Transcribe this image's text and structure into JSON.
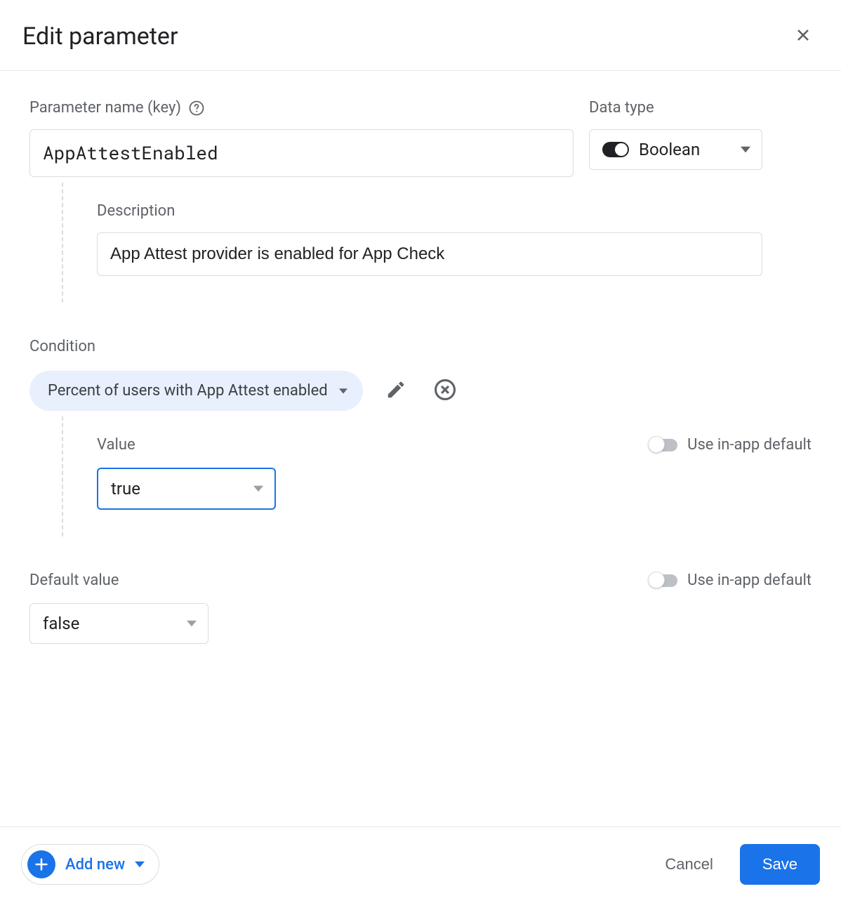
{
  "dialog": {
    "title": "Edit parameter"
  },
  "param": {
    "name_label": "Parameter name (key)",
    "name_value": "AppAttestEnabled",
    "datatype_label": "Data type",
    "datatype_value": "Boolean",
    "description_label": "Description",
    "description_value": "App Attest provider is enabled for App Check"
  },
  "condition": {
    "label": "Condition",
    "chip_text": "Percent of users with App Attest enabled",
    "value_label": "Value",
    "value_selected": "true",
    "use_default_label": "Use in-app default"
  },
  "default": {
    "label": "Default value",
    "value_selected": "false",
    "use_default_label": "Use in-app default"
  },
  "footer": {
    "add_new_label": "Add new",
    "cancel_label": "Cancel",
    "save_label": "Save"
  }
}
